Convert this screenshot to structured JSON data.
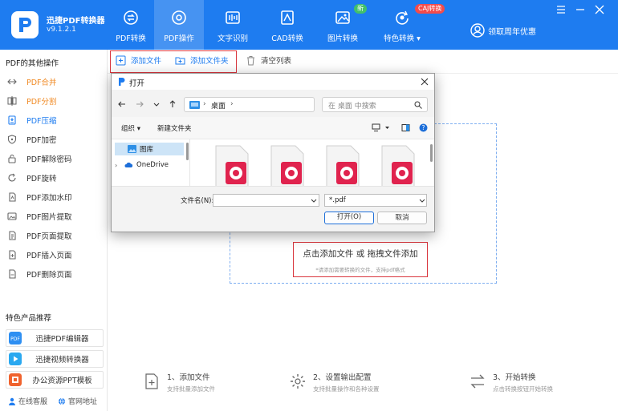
{
  "app": {
    "name": "迅捷PDF转换器",
    "version": "v9.1.2.1",
    "promo": "领取周年优惠",
    "badge_new": "新",
    "badge_caj": "CAJ转换"
  },
  "nav": {
    "items": [
      {
        "label": "PDF转换"
      },
      {
        "label": "PDF操作"
      },
      {
        "label": "文字识别"
      },
      {
        "label": "CAD转换"
      },
      {
        "label": "图片转换"
      },
      {
        "label": "特色转换 ▾"
      }
    ]
  },
  "sidebar": {
    "title": "PDF的其他操作",
    "items": [
      {
        "label": "PDF合并"
      },
      {
        "label": "PDF分割"
      },
      {
        "label": "PDF压缩"
      },
      {
        "label": "PDF加密"
      },
      {
        "label": "PDF解除密码"
      },
      {
        "label": "PDF旋转"
      },
      {
        "label": "PDF添加水印"
      },
      {
        "label": "PDF图片提取"
      },
      {
        "label": "PDF页面提取"
      },
      {
        "label": "PDF插入页面"
      },
      {
        "label": "PDF删除页面"
      }
    ],
    "featured_title": "特色产品推荐",
    "products": [
      {
        "label": "迅捷PDF编辑器"
      },
      {
        "label": "迅捷视频转换器"
      },
      {
        "label": "办公资源PPT模板"
      }
    ],
    "footer": {
      "service": "在线客服",
      "website": "官网地址"
    }
  },
  "toolbar": {
    "add_file": "添加文件",
    "add_folder": "添加文件夹",
    "clear_list": "清空列表"
  },
  "dropzone": {
    "main": "点击添加文件 或 拖拽文件添加",
    "sub": "*请添加需要转换的文件，支持pdf格式"
  },
  "steps": [
    {
      "title": "1、添加文件",
      "sub": "支持批量添加文件"
    },
    {
      "title": "2、设置输出配置",
      "sub": "支持批量操作和各种设置"
    },
    {
      "title": "3、开始转换",
      "sub": "点击转换按钮开始转换"
    }
  ],
  "dialog": {
    "title": "打开",
    "address": "桌面",
    "search_placeholder": "在 桌面 中搜索",
    "organize": "组织 ▾",
    "new_folder": "新建文件夹",
    "tree": [
      {
        "label": "图库"
      },
      {
        "label": "OneDrive"
      }
    ],
    "file_names": [
      "",
      "",
      "",
      ""
    ],
    "filename_label": "文件名(N):",
    "filename_value": "",
    "file_type": "*.pdf",
    "open_button": "打开(O)",
    "cancel_button": "取消"
  },
  "colors": {
    "brand": "#1e7cf0",
    "highlight": "#d9363e",
    "pdf_icon": "#e0234e"
  }
}
